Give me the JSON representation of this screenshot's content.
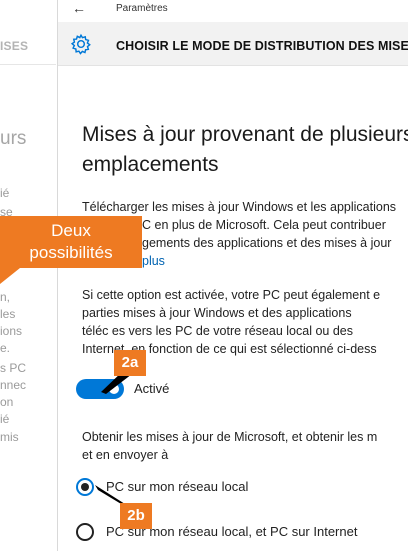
{
  "background_window": {
    "title_fragment": "ISES",
    "heading_fragment": "urs",
    "text_lines": [
      "ié",
      "se",
      "à",
      "n,",
      "les",
      "ions",
      "e.",
      "s PC",
      "nnec",
      "on",
      "ié",
      "mis"
    ]
  },
  "window": {
    "app_name": "Paramètres",
    "back_icon": "←",
    "page_title": "CHOISIR LE MODE DE DISTRIBUTION DES MISES"
  },
  "content": {
    "heading_line1": "Mises à jour provenant de plusieurs",
    "heading_line2": "emplacements",
    "para1_line1": "Télécharger les mises à jour Windows et les applications",
    "para1_line2": "C en plus de Microsoft. Cela peut contribuer",
    "para1_line3": "gements des applications et des mises à jour",
    "para1_link": "plus",
    "para2_line1": "Si cette option est activée, votre PC peut également e",
    "para2_line2": "parties     mises à jour Windows et des applications",
    "para2_line3": "téléc      es vers les PC de votre réseau local ou des",
    "para2_line4": "Internet, en fonction de ce qui est sélectionné ci-dess",
    "toggle_label": "Activé",
    "para3_line1": "Obtenir les mises à jour de Microsoft, et obtenir les m",
    "para3_line2": "et en envoyer à",
    "radio1_label": "PC sur mon réseau local",
    "radio2_label": "PC sur mon réseau local, et PC sur Internet"
  },
  "annotations": {
    "callout_line1": "Deux",
    "callout_line2": "possibilités",
    "badge_2a": "2a",
    "badge_2b": "2b"
  },
  "state": {
    "toggle_on": true,
    "selected_radio": 1
  },
  "colors": {
    "accent": "#0078d7",
    "callout": "#ee7a22",
    "header_bg": "#f2f2f2"
  },
  "icons": {
    "back": "arrow-left-icon",
    "settings": "gear-icon"
  }
}
